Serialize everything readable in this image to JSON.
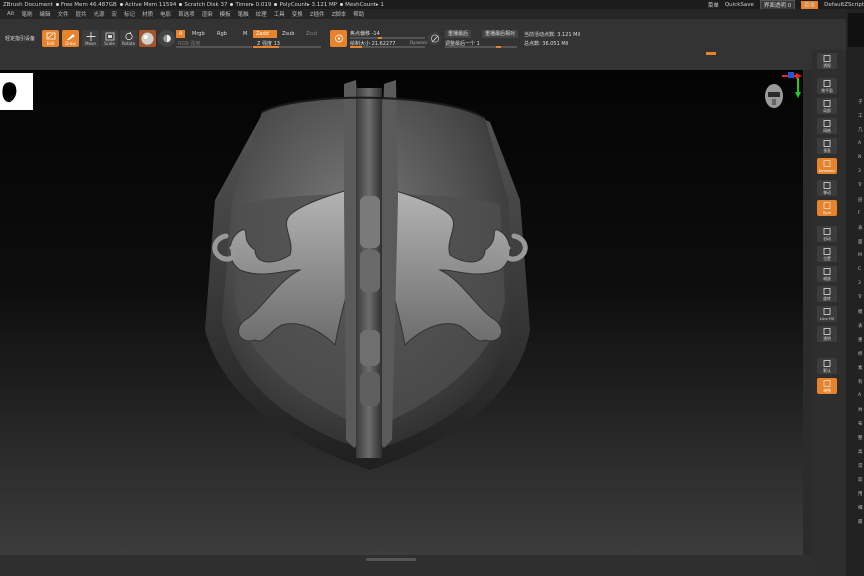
{
  "titlebar": {
    "doc": "ZBrush Document",
    "free_mem": "Free Mem 46.487GB",
    "active_mem": "Active Mem 11594",
    "scratch": "Scratch Disk 37",
    "timer": "Timer▸ 0.019",
    "poly": "PolyCount▸ 3.121 MP",
    "mesh": "MeshCount▸ 1",
    "right_1": "菜单",
    "quicksave": "QuickSave",
    "transparency": "界面透明 0",
    "menus_btn": "菜单",
    "zscript": "DefaultZScript"
  },
  "menubar": [
    "Alt",
    "笔刷",
    "编辑",
    "文件",
    "层共",
    "光源",
    "宏",
    "标记",
    "材质",
    "电影",
    "首选项",
    "渲染",
    "模板",
    "笔触",
    "纹理",
    "工具",
    "变换",
    "Z插件",
    "Z脚本",
    "帮助"
  ],
  "shelf": {
    "lightbox": "轻定指引设备",
    "edit": "Edit",
    "draw": "Draw",
    "move": "Move",
    "scale": "Scale",
    "rotate": "Rotate",
    "a_chip": "A",
    "mrgb": "Mrgb",
    "rgb": "Rgb",
    "m": "M",
    "rgb_strength": "RGB 强度",
    "zadd": "Zadd",
    "zsub": "Zsub",
    "zcut": "Zcut",
    "z_intensity": "Z 强度 13",
    "focal_shift": "焦点偏移 -14",
    "draw_size": "绘制大小 21.62277",
    "dynamic": "Dynamic",
    "replay_last": "重播最后",
    "replay_last_rel": "重播最后相对",
    "adjust_last": "调整最后一个 1",
    "active_points": "当前活动点数: 3.121 Mil",
    "total_points": "总点数: 36.051 Mil"
  },
  "right_tools": [
    "透视",
    "地平面",
    "局部",
    "网格",
    "垂直",
    "Dynamic",
    "移动",
    "Sym",
    "自动",
    "位置",
    "缩放",
    "旋转",
    "Line Fill",
    "透明",
    "默认",
    "单独"
  ],
  "right_panel_labels": [
    "子",
    "工",
    "几",
    "A",
    "N",
    "3",
    "Tr",
    "层",
    "F",
    "表",
    "面",
    "M",
    "C",
    "3",
    "Tr",
    "模",
    "表",
    "重",
    "修",
    "素",
    "有",
    "A",
    "共",
    "布",
    "整",
    "高",
    "常",
    "软",
    "用",
    "细",
    "最"
  ],
  "colors": {
    "accent": "#e7832a",
    "panel": "#333333",
    "viewport_dark": "#050505"
  },
  "icons": [
    "edit-icon",
    "draw-icon",
    "move-icon",
    "scale-icon",
    "rotate-icon",
    "material-sphere-icon",
    "gyro-axis-icon",
    "head-orientation-icon"
  ]
}
